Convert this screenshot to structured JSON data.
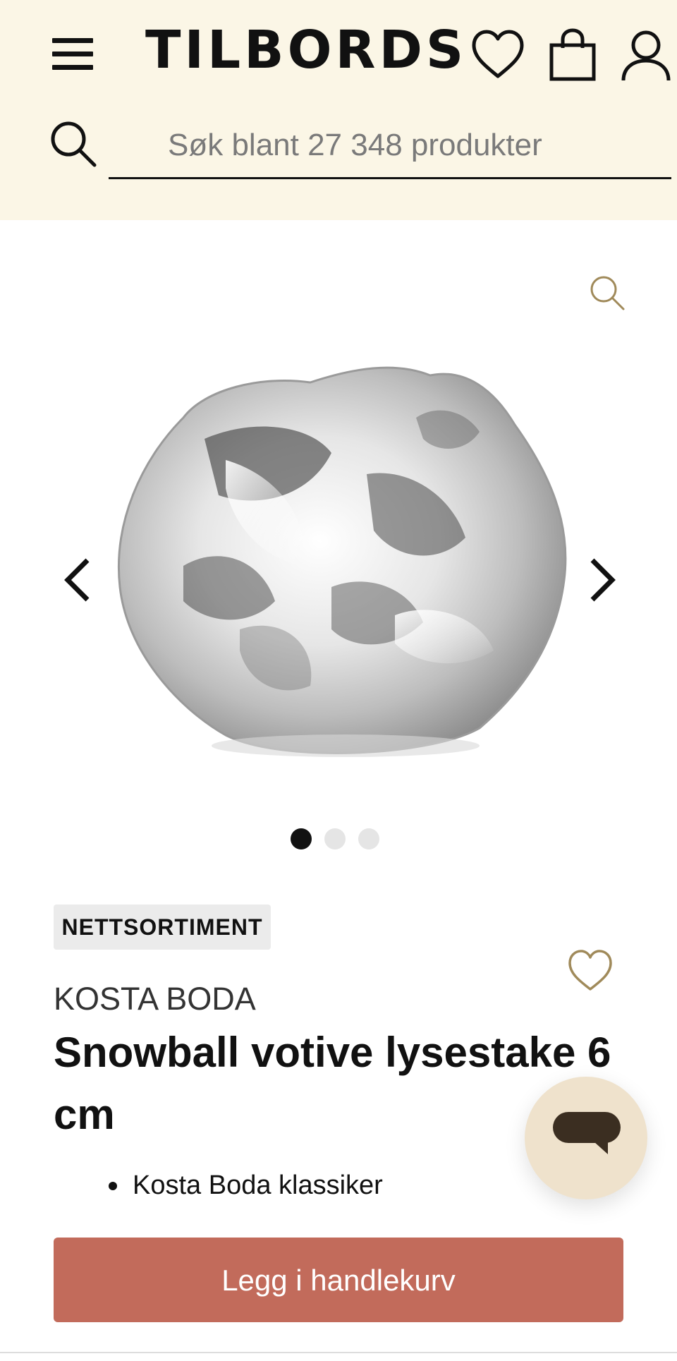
{
  "header": {
    "logo_text": "TILBORDS",
    "menu_icon": "hamburger-menu-icon",
    "wishlist_icon": "heart-outline-icon",
    "cart_icon": "shopping-bag-icon",
    "account_icon": "user-icon",
    "background_color": "#fbf6e6"
  },
  "search": {
    "icon": "search-icon",
    "placeholder": "Søk blant 27 348 produkter",
    "value": ""
  },
  "gallery": {
    "zoom_icon": "zoom-magnifier-icon",
    "prev_icon": "chevron-left-icon",
    "next_icon": "chevron-right-icon",
    "image_alt": "Snowball votive lysestake 6 cm",
    "slide_count": 3,
    "active_slide": 1
  },
  "product": {
    "badge": "NETTSORTIMENT",
    "brand": "KOSTA BODA",
    "title": "Snowball votive lysestake 6 cm",
    "features": [
      "Kosta Boda klassiker"
    ],
    "wishlist_icon": "heart-outline-icon",
    "add_to_cart_label": "Legg i handlekurv"
  },
  "chat": {
    "icon": "chat-bubble-icon"
  },
  "colors": {
    "accent_button": "#c26b5b",
    "icon_gold": "#a08a5a",
    "chat_background": "#efe2cc"
  }
}
